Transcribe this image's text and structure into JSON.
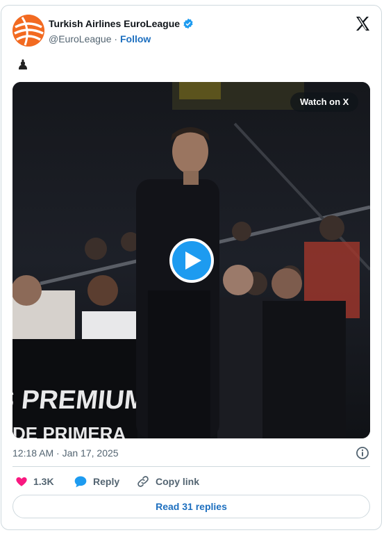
{
  "account": {
    "name": "Turkish Airlines EuroLeague",
    "handle": "@EuroLeague",
    "separator": " · ",
    "follow_label": "Follow"
  },
  "tweet": {
    "body_emoji": "♟",
    "timestamp": "12:18 AM · Jan 17, 2025"
  },
  "media": {
    "watch_label": "Watch on X",
    "court_text_top": "ES PREMIUM,",
    "court_text_bottom": "DE PRIMERA"
  },
  "actions": {
    "like_count": "1.3K",
    "reply_label": "Reply",
    "copy_link_label": "Copy link",
    "read_replies_label": "Read 31 replies"
  },
  "colors": {
    "accent": "#1d9bf0",
    "link": "#1d6fbf",
    "like": "#f91880",
    "brand_orange": "#f26a21",
    "muted": "#536471",
    "border": "#cfd9de"
  },
  "icons": [
    "euroleague-logo",
    "verified-badge-icon",
    "x-logo-icon",
    "play-icon",
    "info-icon",
    "heart-icon",
    "reply-bubble-icon",
    "link-icon"
  ]
}
